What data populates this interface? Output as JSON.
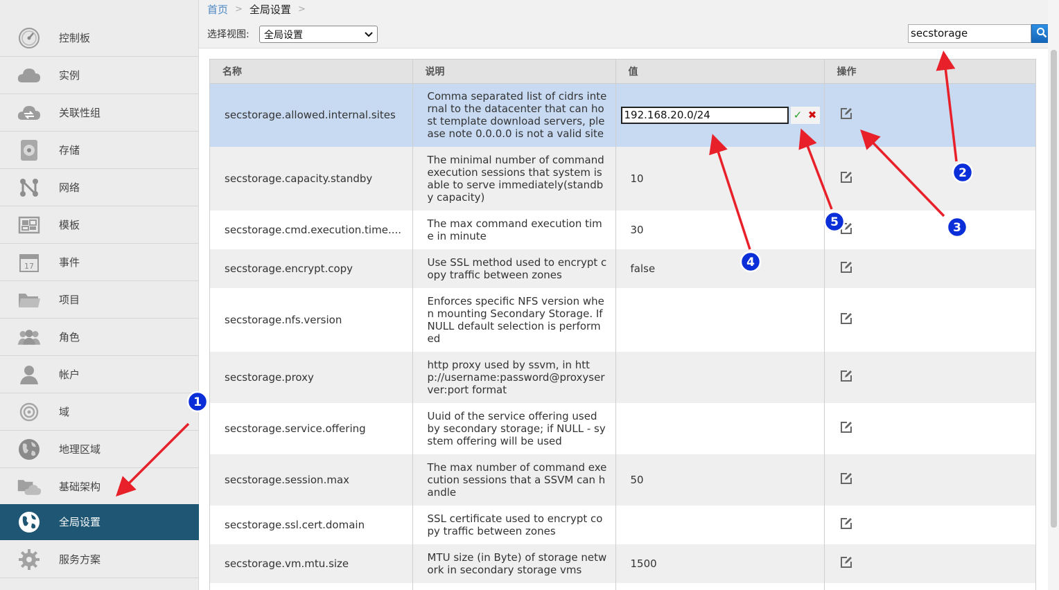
{
  "sidebar": {
    "items": [
      {
        "label": "控制板",
        "icon": "dashboard-icon"
      },
      {
        "label": "实例",
        "icon": "cloud-icon"
      },
      {
        "label": "关联性组",
        "icon": "affinity-group-icon"
      },
      {
        "label": "存储",
        "icon": "storage-icon"
      },
      {
        "label": "网络",
        "icon": "network-icon"
      },
      {
        "label": "模板",
        "icon": "template-icon"
      },
      {
        "label": "事件",
        "icon": "calendar-icon"
      },
      {
        "label": "项目",
        "icon": "folder-icon"
      },
      {
        "label": "角色",
        "icon": "roles-icon"
      },
      {
        "label": "帐户",
        "icon": "user-icon"
      },
      {
        "label": "域",
        "icon": "domain-icon"
      },
      {
        "label": "地理区域",
        "icon": "globe-icon"
      },
      {
        "label": "基础架构",
        "icon": "infrastructure-icon"
      },
      {
        "label": "全局设置",
        "icon": "globe-settings-icon",
        "active": true
      },
      {
        "label": "服务方案",
        "icon": "gear-icon"
      }
    ]
  },
  "breadcrumb": {
    "home": "首页",
    "current": "全局设置",
    "separator": ">"
  },
  "view_selector": {
    "label": "选择视图:",
    "value": "全局设置"
  },
  "search": {
    "value": "secstorage"
  },
  "table": {
    "headers": {
      "name": "名称",
      "description": "说明",
      "value": "值",
      "actions": "操作"
    },
    "rows": [
      {
        "name": "secstorage.allowed.internal.sites",
        "description": "Comma separated list of cidrs internal to the datacenter that can host template download servers, please note 0.0.0.0 is not a valid site",
        "value": "192.168.20.0/24"
      },
      {
        "name": "secstorage.capacity.standby",
        "description": "The minimal number of command execution sessions that system is able to serve immediately(standby capacity)",
        "value": "10"
      },
      {
        "name": "secstorage.cmd.execution.time....",
        "description": "The max command execution time in minute",
        "value": "30"
      },
      {
        "name": "secstorage.encrypt.copy",
        "description": "Use SSL method used to encrypt copy traffic between zones",
        "value": "false"
      },
      {
        "name": "secstorage.nfs.version",
        "description": "Enforces specific NFS version when mounting Secondary Storage. If NULL default selection is performed",
        "value": ""
      },
      {
        "name": "secstorage.proxy",
        "description": "http proxy used by ssvm, in http://username:password@proxyserver:port format",
        "value": ""
      },
      {
        "name": "secstorage.service.offering",
        "description": "Uuid of the service offering used by secondary storage; if NULL - system offering will be used",
        "value": ""
      },
      {
        "name": "secstorage.session.max",
        "description": "The max number of command execution sessions that a SSVM can handle",
        "value": "50"
      },
      {
        "name": "secstorage.ssl.cert.domain",
        "description": "SSL certificate used to encrypt copy traffic between zones",
        "value": ""
      },
      {
        "name": "secstorage.vm.mtu.size",
        "description": "MTU size (in Byte) of storage network in secondary storage vms",
        "value": "1500"
      }
    ]
  },
  "annotations": {
    "markers": [
      "1",
      "2",
      "3",
      "4",
      "5"
    ],
    "colors": {
      "arrow": "#e8202a",
      "marker_fill": "#0a2ed8"
    }
  },
  "colors": {
    "active_sidebar": "#1e5674",
    "selected_row": "#c7daf2",
    "link": "#4a86c5"
  }
}
